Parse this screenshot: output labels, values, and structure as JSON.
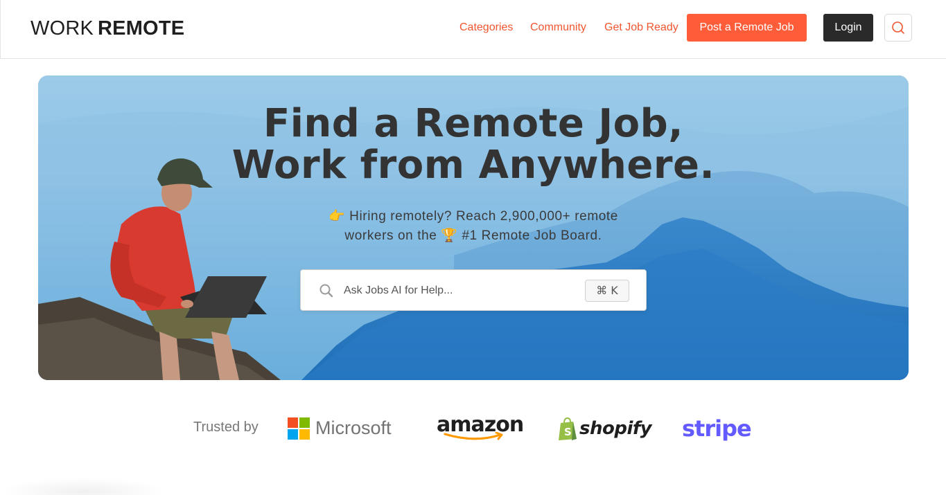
{
  "header": {
    "logo": {
      "word1": "WORK",
      "word2": "REMOTE"
    },
    "nav": [
      {
        "label": "Categories"
      },
      {
        "label": "Community"
      },
      {
        "label": "Get Job Ready"
      }
    ],
    "post_job_label": "Post a Remote Job",
    "login_label": "Login",
    "search_icon": "search-icon"
  },
  "hero": {
    "title_line1": "Find a Remote Job,",
    "title_line2": "Work from Anywhere.",
    "subtitle_line1": "👉 Hiring remotely? Reach 2,900,000+ remote",
    "subtitle_line2": "workers on the 🏆 #1 Remote Job Board.",
    "search": {
      "placeholder": "Ask Jobs AI for Help...",
      "shortcut": "⌘ K"
    }
  },
  "trusted": {
    "label": "Trusted by",
    "logos": [
      "Microsoft",
      "amazon",
      "shopify",
      "stripe"
    ]
  },
  "colors": {
    "accent": "#ff5c3a",
    "nav_link": "#f0552f",
    "login_bg": "#2a2a2a",
    "stripe": "#635bff"
  }
}
